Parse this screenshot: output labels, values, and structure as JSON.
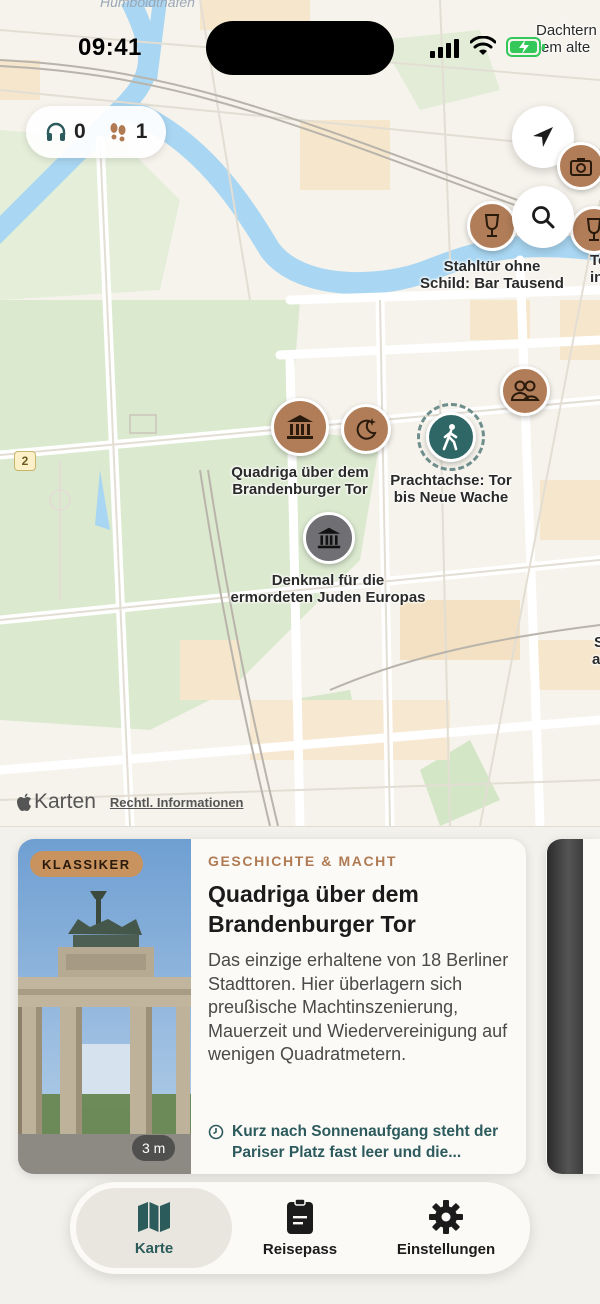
{
  "status": {
    "time": "09:41"
  },
  "counter": {
    "listen_count": "0",
    "visit_count": "1"
  },
  "map": {
    "top_labels": {
      "river": "Humboldthafen",
      "corner_1": "Dachtern",
      "corner_2": "em alte"
    },
    "road_number": "2",
    "pois": [
      {
        "name": "Stahltür ohne\nSchild: Bar Tausend",
        "icon": "wine-glass-icon"
      },
      {
        "name": "Quadriga über dem\nBrandenburger Tor",
        "icon": "museum-icon"
      },
      {
        "name": "Prachtachse: Tor\nbis Neue Wache",
        "icon": "walking-icon"
      },
      {
        "name": "Denkmal für die\nermordeten Juden Europas",
        "icon": "museum-icon"
      }
    ],
    "edge_labels": {
      "right_1": "Te",
      "right_2": "in",
      "right_3": "S",
      "right_4": "a"
    },
    "attribution": {
      "brand": "Karten",
      "legal": "Rechtl. Informationen"
    }
  },
  "card": {
    "badge": "KLASSIKER",
    "duration": "3 m",
    "category": "GESCHICHTE & MACHT",
    "title": "Quadriga über dem Brandenburger Tor",
    "description": "Das einzige erhaltene von 18 Berliner Stadttoren. Hier überlagern sich preußische Machtinszenierung, Mauerzeit und Wiedervereinigung auf wenigen Quadratmetern.",
    "tip": "Kurz nach Sonnenaufgang steht der Pariser Platz fast leer und die..."
  },
  "tabs": [
    {
      "label": "Karte",
      "icon": "map-icon",
      "active": true
    },
    {
      "label": "Reisepass",
      "icon": "passport-icon",
      "active": false
    },
    {
      "label": "Einstellungen",
      "icon": "gear-icon",
      "active": false
    }
  ],
  "colors": {
    "accent_brown": "#b17d58",
    "accent_teal": "#2f6666",
    "category": "#b07a53"
  }
}
